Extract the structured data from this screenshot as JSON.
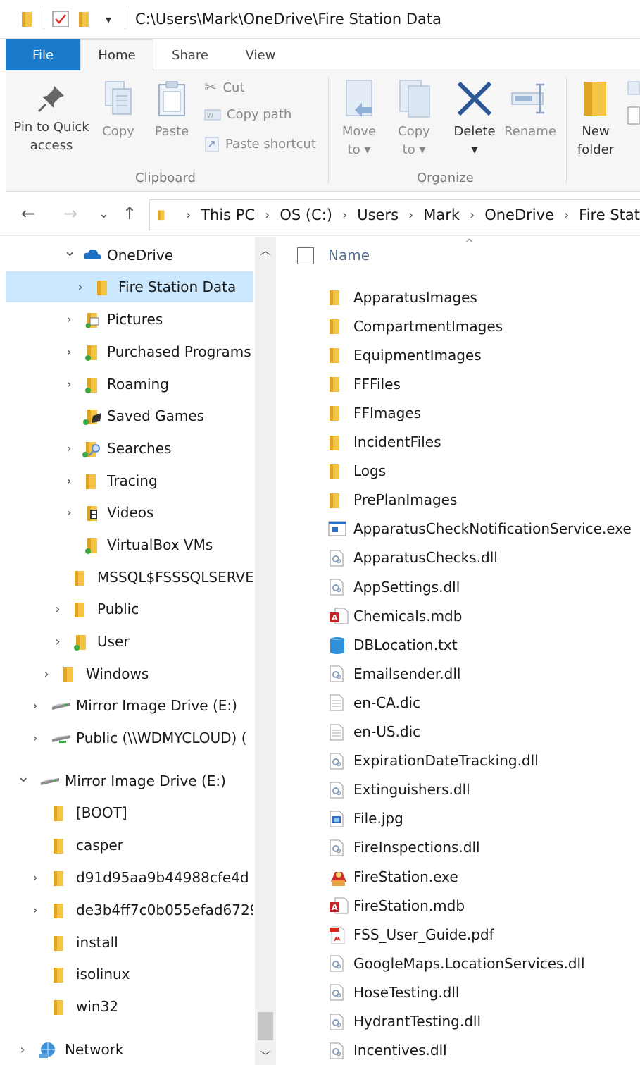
{
  "window": {
    "title_path": "C:\\Users\\Mark\\OneDrive\\Fire Station Data",
    "qa_dropdown": "▾"
  },
  "tabs": [
    {
      "label": "File"
    },
    {
      "label": "Home"
    },
    {
      "label": "Share"
    },
    {
      "label": "View"
    }
  ],
  "ribbon": {
    "clipboard": {
      "pin_label": "Pin to Quick\naccess",
      "copy_label": "Copy",
      "paste_label": "Paste",
      "cut_label": "Cut",
      "copy_path_label": "Copy path",
      "paste_shortcut_label": "Paste shortcut",
      "group_label": "Clipboard"
    },
    "organize": {
      "move_to_label": "Move\nto ▾",
      "copy_to_label": "Copy\nto ▾",
      "delete_label": "Delete\n▾",
      "rename_label": "Rename",
      "group_label": "Organize"
    },
    "new": {
      "new_folder_label": "New\nfolder"
    }
  },
  "address": {
    "crumbs": [
      "This PC",
      "OS (C:)",
      "Users",
      "Mark",
      "OneDrive",
      "Fire Stat"
    ]
  },
  "nav_items": [
    {
      "label": "OneDrive",
      "chevron": "expanded",
      "icon": "onedrive-cloud-icon"
    },
    {
      "label": "Fire Station Data",
      "chevron": "collapsed",
      "icon": "folder-icon",
      "selected": true
    },
    {
      "label": "Pictures",
      "chevron": "collapsed",
      "icon": "pictures-folder-icon"
    },
    {
      "label": "Purchased Programs",
      "chevron": "collapsed",
      "icon": "folder-sync-icon"
    },
    {
      "label": "Roaming",
      "chevron": "collapsed",
      "icon": "folder-sync-icon"
    },
    {
      "label": "Saved Games",
      "chevron": "none",
      "icon": "saved-games-folder-icon"
    },
    {
      "label": "Searches",
      "chevron": "collapsed",
      "icon": "searches-folder-icon"
    },
    {
      "label": "Tracing",
      "chevron": "collapsed",
      "icon": "folder-icon"
    },
    {
      "label": "Videos",
      "chevron": "collapsed",
      "icon": "videos-folder-icon"
    },
    {
      "label": "VirtualBox VMs",
      "chevron": "none",
      "icon": "folder-sync-icon"
    },
    {
      "label": "MSSQL$FSSSQLSERVE",
      "chevron": "none",
      "icon": "folder-icon"
    },
    {
      "label": "Public",
      "chevron": "collapsed",
      "icon": "folder-icon"
    },
    {
      "label": "User",
      "chevron": "collapsed",
      "icon": "folder-sync-icon"
    },
    {
      "label": "Windows",
      "chevron": "collapsed",
      "icon": "folder-icon"
    },
    {
      "label": "Mirror Image Drive (E:)",
      "chevron": "collapsed",
      "icon": "drive-icon"
    },
    {
      "label": "Public (\\\\WDMYCLOUD) (",
      "chevron": "collapsed",
      "icon": "network-drive-icon"
    },
    {
      "label": "Mirror Image Drive (E:)",
      "chevron": "expanded",
      "icon": "drive-icon"
    },
    {
      "label": "[BOOT]",
      "chevron": "none",
      "icon": "folder-icon"
    },
    {
      "label": "casper",
      "chevron": "none",
      "icon": "folder-icon"
    },
    {
      "label": "d91d95aa9b44988cfe4d",
      "chevron": "collapsed",
      "icon": "folder-icon"
    },
    {
      "label": "de3b4ff7c0b055efad6729",
      "chevron": "collapsed",
      "icon": "folder-icon"
    },
    {
      "label": "install",
      "chevron": "none",
      "icon": "folder-icon"
    },
    {
      "label": "isolinux",
      "chevron": "none",
      "icon": "folder-icon"
    },
    {
      "label": "win32",
      "chevron": "none",
      "icon": "folder-icon"
    },
    {
      "label": "Network",
      "chevron": "collapsed",
      "icon": "network-icon"
    }
  ],
  "file_list": {
    "column_name": "Name",
    "sort_indicator": "^",
    "files": [
      {
        "name": "ApparatusImages",
        "icon": "folder-icon"
      },
      {
        "name": "CompartmentImages",
        "icon": "folder-icon"
      },
      {
        "name": "EquipmentImages",
        "icon": "folder-icon"
      },
      {
        "name": "FFFiles",
        "icon": "folder-icon"
      },
      {
        "name": "FFImages",
        "icon": "folder-icon"
      },
      {
        "name": "IncidentFiles",
        "icon": "folder-icon"
      },
      {
        "name": "Logs",
        "icon": "folder-icon"
      },
      {
        "name": "PrePlanImages",
        "icon": "folder-icon"
      },
      {
        "name": "ApparatusCheckNotificationService.exe",
        "icon": "exe-window-icon"
      },
      {
        "name": "ApparatusChecks.dll",
        "icon": "dll-file-icon"
      },
      {
        "name": "AppSettings.dll",
        "icon": "dll-file-icon"
      },
      {
        "name": "Chemicals.mdb",
        "icon": "access-db-icon"
      },
      {
        "name": "DBLocation.txt",
        "icon": "blue-text-file-icon"
      },
      {
        "name": "Emailsender.dll",
        "icon": "dll-file-icon"
      },
      {
        "name": "en-CA.dic",
        "icon": "text-file-icon"
      },
      {
        "name": "en-US.dic",
        "icon": "text-file-icon"
      },
      {
        "name": "ExpirationDateTracking.dll",
        "icon": "dll-file-icon"
      },
      {
        "name": "Extinguishers.dll",
        "icon": "dll-file-icon"
      },
      {
        "name": "File.jpg",
        "icon": "image-file-icon"
      },
      {
        "name": "FireInspections.dll",
        "icon": "dll-file-icon"
      },
      {
        "name": "FireStation.exe",
        "icon": "firestation-app-icon"
      },
      {
        "name": "FireStation.mdb",
        "icon": "access-db-icon"
      },
      {
        "name": "FSS_User_Guide.pdf",
        "icon": "pdf-file-icon"
      },
      {
        "name": "GoogleMaps.LocationServices.dll",
        "icon": "dll-file-icon"
      },
      {
        "name": "HoseTesting.dll",
        "icon": "dll-file-icon"
      },
      {
        "name": "HydrantTesting.dll",
        "icon": "dll-file-icon"
      },
      {
        "name": "Incentives.dll",
        "icon": "dll-file-icon"
      }
    ]
  },
  "colors": {
    "file_tab": "#1979ca",
    "selected_nav": "#cce8ff",
    "folder_yellow": "#f4c542",
    "folder_dark": "#e0a526"
  }
}
